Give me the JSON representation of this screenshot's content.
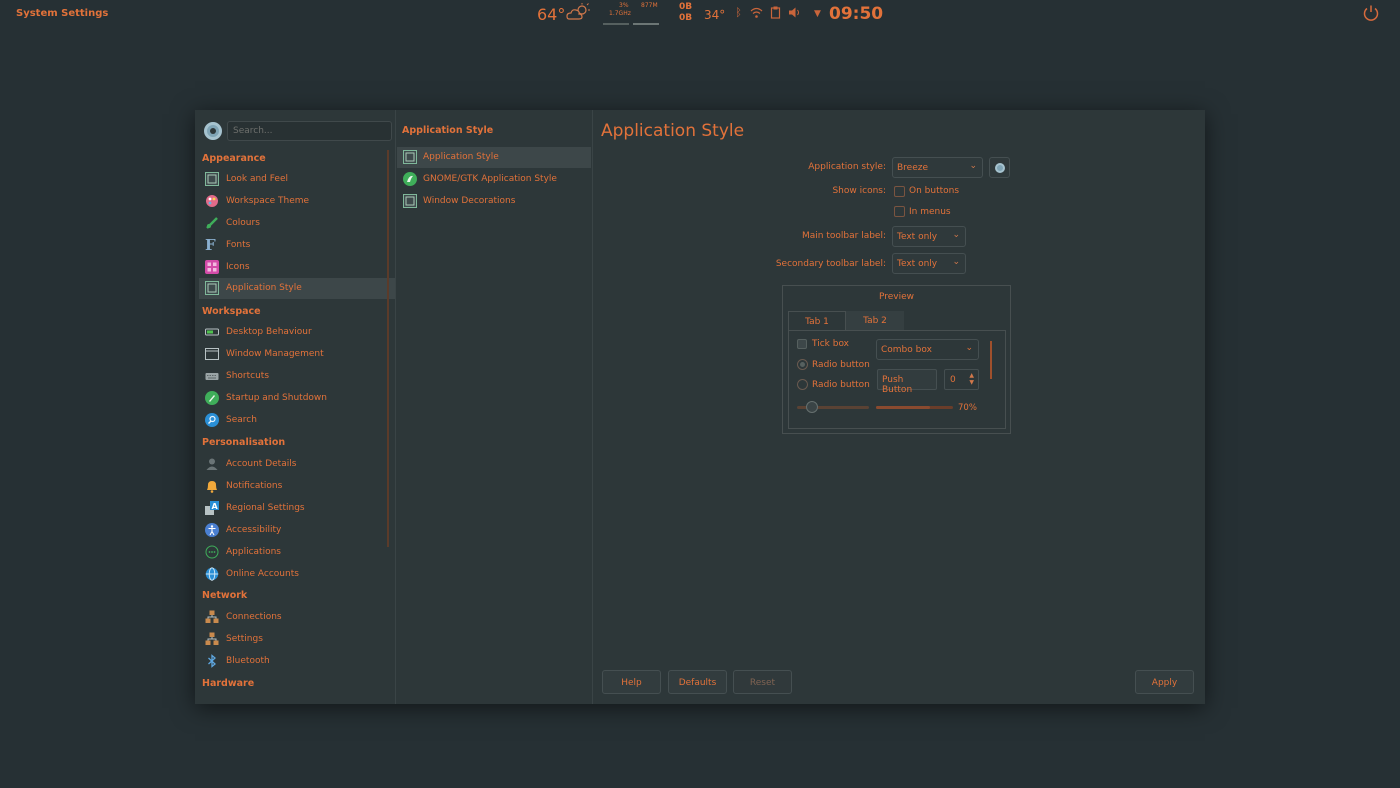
{
  "topbar": {
    "app_title": "System Settings",
    "weather_temp": "64°",
    "cpu_percent": "3%",
    "cpu_freq": "1.7GHz",
    "memory": "877M",
    "net_up": "0B",
    "net_down": "0B",
    "cpu_temp": "34°",
    "clock": "09:50"
  },
  "sidebar": {
    "search_placeholder": "Search...",
    "sections": {
      "appearance": "Appearance",
      "workspace": "Workspace",
      "personalisation": "Personalisation",
      "network": "Network",
      "hardware": "Hardware"
    },
    "items": {
      "look_and_feel": "Look and Feel",
      "workspace_theme": "Workspace Theme",
      "colours": "Colours",
      "fonts": "Fonts",
      "icons": "Icons",
      "application_style": "Application Style",
      "desktop_behaviour": "Desktop Behaviour",
      "window_management": "Window Management",
      "shortcuts": "Shortcuts",
      "startup_and_shutdown": "Startup and Shutdown",
      "search": "Search",
      "account_details": "Account Details",
      "notifications": "Notifications",
      "regional_settings": "Regional Settings",
      "accessibility": "Accessibility",
      "applications": "Applications",
      "online_accounts": "Online Accounts",
      "connections": "Connections",
      "settings": "Settings",
      "bluetooth": "Bluetooth"
    }
  },
  "subnav": {
    "title": "Application Style",
    "items": [
      "Application Style",
      "GNOME/GTK Application Style",
      "Window Decorations"
    ]
  },
  "main": {
    "title": "Application Style",
    "application_style_label": "Application style:",
    "application_style_value": "Breeze",
    "show_icons_label": "Show icons:",
    "on_buttons": "On buttons",
    "in_menus": "In menus",
    "main_toolbar_label": "Main toolbar label:",
    "main_toolbar_value": "Text only",
    "secondary_toolbar_label": "Secondary toolbar label:",
    "secondary_toolbar_value": "Text only",
    "preview": {
      "title": "Preview",
      "tabs": [
        "Tab 1",
        "Tab 2"
      ],
      "tick_box": "Tick box",
      "radio1": "Radio button",
      "radio2": "Radio button",
      "combo": "Combo box",
      "push_button": "Push Button",
      "spin_value": "0",
      "progress_label": "70%",
      "progress": 0.7
    }
  },
  "buttons": {
    "help": "Help",
    "defaults": "Defaults",
    "reset": "Reset",
    "apply": "Apply"
  },
  "colors": {
    "accent": "#e2723a",
    "background": "#263034",
    "window": "#2d3739",
    "selection": "#3d4749"
  }
}
